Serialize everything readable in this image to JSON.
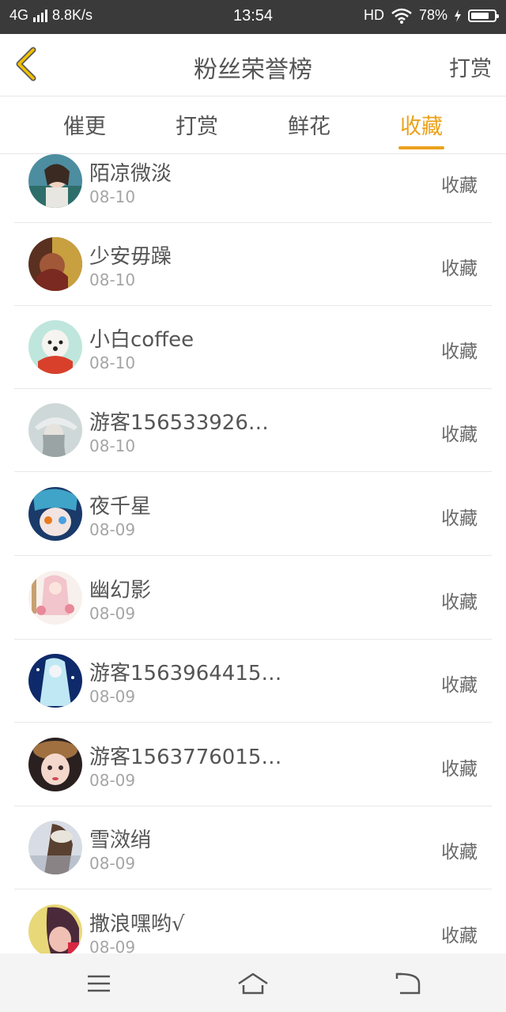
{
  "status_bar": {
    "network": "4G",
    "speed": "8.8K/s",
    "time": "13:54",
    "hd": "HD",
    "battery": "78%",
    "battery_level": 0.78
  },
  "header": {
    "title": "粉丝荣誉榜",
    "right_action": "打赏"
  },
  "tabs": [
    {
      "label": "催更"
    },
    {
      "label": "打赏"
    },
    {
      "label": "鲜花"
    },
    {
      "label": "收藏",
      "active": true
    }
  ],
  "list": [
    {
      "name": "陌凉微淡",
      "date": "08-10",
      "action": "收藏"
    },
    {
      "name": "少安毋躁",
      "date": "08-10",
      "action": "收藏"
    },
    {
      "name": "小白coffee",
      "date": "08-10",
      "action": "收藏"
    },
    {
      "name": "游客156533926…",
      "date": "08-10",
      "action": "收藏"
    },
    {
      "name": "夜千星",
      "date": "08-09",
      "action": "收藏"
    },
    {
      "name": "幽幻影",
      "date": "08-09",
      "action": "收藏"
    },
    {
      "name": "游客1563964415…",
      "date": "08-09",
      "action": "收藏"
    },
    {
      "name": "游客1563776015…",
      "date": "08-09",
      "action": "收藏"
    },
    {
      "name": "雪滧绡",
      "date": "08-09",
      "action": "收藏"
    },
    {
      "name": "撒浪嘿哟√",
      "date": "08-09",
      "action": "收藏"
    }
  ],
  "colors": {
    "accent": "#eba21d",
    "status_bar": "#3a3a3a"
  },
  "icons": {
    "back": "chevron-left-icon",
    "menu": "menu-icon",
    "home": "home-icon",
    "return": "return-icon"
  }
}
